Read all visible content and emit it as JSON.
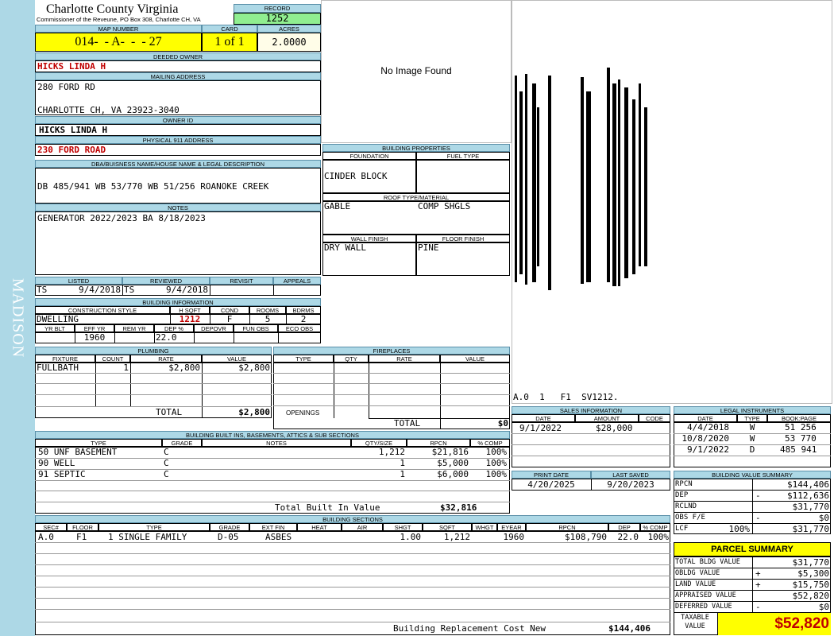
{
  "sidebar_text": "MADISON",
  "county": "Charlotte County Virginia",
  "commissioner": "Commissioner of the Reveune, PO Box 308, Charlotte CH, VA",
  "record": {
    "label": "RECORD",
    "value": "1252"
  },
  "map_number": {
    "label": "MAP NUMBER",
    "value": "014-  - A-  -  - 27"
  },
  "card": {
    "label": "CARD",
    "value": "1 of 1"
  },
  "acres": {
    "label": "ACRES",
    "value": "2.0000"
  },
  "deeded_owner": {
    "label": "DEEDED OWNER",
    "value": "HICKS LINDA H"
  },
  "mailing_address": {
    "label": "MAILING ADDRESS",
    "line1": "280 FORD RD",
    "line2": "CHARLOTTE CH, VA 23923-3040"
  },
  "owner_id": {
    "label": "OWNER ID",
    "value": "HICKS LINDA H"
  },
  "physical_address": {
    "label": "PHYSICAL 911 ADDRESS",
    "value": "230 FORD ROAD"
  },
  "legal": {
    "label": "DBA/BUISNESS NAME/HOUSE NAME & LEGAL DESCRIPTION",
    "value": "DB 485/941 WB 53/770 WB 51/256 ROANOKE CREEK"
  },
  "notes": {
    "label": "NOTES",
    "value": "GENERATOR 2022/2023 BA 8/18/2023"
  },
  "photo": {
    "text": "No Image Found"
  },
  "sketch_caption": "A.0  1   F1  SV1212.",
  "building_properties": {
    "label": "BUILDING PROPERTIES",
    "foundation_label": "FOUNDATION",
    "foundation": "CINDER BLOCK",
    "fuel_label": "FUEL TYPE",
    "fuel": "",
    "roof_label": "ROOF TYPE/MATERIAL",
    "roof_type": "GABLE",
    "roof_material": "COMP SHGLS",
    "wall_label": "WALL FINISH",
    "wall": "DRY WALL",
    "floor_label": "FLOOR FINISH",
    "floor": "PINE"
  },
  "listing": {
    "listed_label": "LISTED",
    "listed_by": "TS",
    "listed_date": "9/4/2018",
    "reviewed_label": "REVIEWED",
    "reviewed_by": "TS",
    "reviewed_date": "9/4/2018",
    "revisit_label": "REVISIT",
    "appeals_label": "APPEALS"
  },
  "building_info": {
    "label": "BUILDING INFORMATION",
    "style_label": "CONSTRUCTION STYLE",
    "style": "DWELLING",
    "hsqft_label": "H SQFT",
    "hsqft": "1212",
    "cond_label": "COND",
    "cond": "F",
    "rooms_label": "ROOMS",
    "rooms": "5",
    "bdrms_label": "BDRMS",
    "bdrms": "2",
    "yrblt_label": "YR BLT",
    "yrblt": "",
    "effyr_label": "EFF YR",
    "effyr": "1960",
    "remyr_label": "REM YR",
    "remyr": "",
    "dep_label": "DEP %",
    "dep": "22.0",
    "depovr_label": "DEPOVR",
    "funobs_label": "FUN OBS",
    "ecoobs_label": "ECO OBS"
  },
  "plumbing": {
    "label": "PLUMBING",
    "headers": [
      "FIXTURE",
      "COUNT",
      "RATE",
      "VALUE"
    ],
    "rows": [
      [
        "FULLBATH",
        "1",
        "$2,800",
        "$2,800"
      ]
    ],
    "total_label": "TOTAL",
    "total": "$2,800"
  },
  "fireplaces": {
    "label": "FIREPLACES",
    "headers": [
      "TYPE",
      "QTY",
      "RATE",
      "VALUE"
    ],
    "openings_label": "OPENINGS",
    "total_label": "TOTAL",
    "total": "$0"
  },
  "builtins": {
    "label": "BUILDING BUILT INS, BASEMENTS, ATTICS & SUB SECTIONS",
    "headers": [
      "TYPE",
      "GRADE",
      "NOTES",
      "QTY/SIZE",
      "RPCN",
      "% COMP"
    ],
    "rows": [
      [
        "50 UNF BASEMENT",
        "C",
        "",
        "1,212",
        "$21,816",
        "100%"
      ],
      [
        "90 WELL",
        "C",
        "",
        "1",
        "$5,000",
        "100%"
      ],
      [
        "91 SEPTIC",
        "C",
        "",
        "1",
        "$6,000",
        "100%"
      ]
    ],
    "total_label": "Total Built In Value",
    "total": "$32,816"
  },
  "sections": {
    "label": "BUILDING SECTIONS",
    "headers": [
      "SEC#",
      "FLOOR",
      "TYPE",
      "GRADE",
      "EXT FIN",
      "HEAT",
      "AIR",
      "SHGT",
      "SQFT",
      "WHGT",
      "EYEAR",
      "RPCN",
      "DEP",
      "% COMP"
    ],
    "rows": [
      [
        "A.0",
        "F1",
        "1 SINGLE FAMILY",
        "D-05",
        "ASBES",
        "",
        "",
        "1.00",
        "1,212",
        "",
        "1960",
        "$108,790",
        "22.0",
        "100%"
      ]
    ],
    "total_label": "Building Replacement Cost New",
    "total": "$144,406"
  },
  "sales": {
    "label": "SALES INFORMATION",
    "headers": [
      "DATE",
      "AMOUNT",
      "CODE"
    ],
    "rows": [
      [
        "9/1/2022",
        "$28,000",
        ""
      ]
    ]
  },
  "legal_instruments": {
    "label": "LEGAL INSTRUMENTS",
    "headers": [
      "DATE",
      "TYPE",
      "BOOK:PAGE"
    ],
    "rows": [
      [
        "4/4/2018",
        "W",
        "51 256"
      ],
      [
        "10/8/2020",
        "W",
        "53 770"
      ],
      [
        "9/1/2022",
        "D",
        "485 941"
      ]
    ]
  },
  "dates": {
    "print_label": "PRINT DATE",
    "print": "4/20/2025",
    "saved_label": "LAST SAVED",
    "saved": "9/20/2023"
  },
  "value_summary": {
    "label": "BUILDING VALUE SUMMARY",
    "rpcn_label": "RPCN",
    "rpcn": "$144,406",
    "dep_label": "DEP",
    "dep_sign": "-",
    "dep": "$112,636",
    "rclnd_label": "RCLND",
    "rclnd": "$31,770",
    "obs_label": "OBS F/E",
    "obs_sign": "-",
    "obs": "$0",
    "lcr_label": "LCF",
    "lcr_pct": "100%",
    "lcr": "$31,770"
  },
  "parcel_summary": {
    "label": "PARCEL SUMMARY",
    "total_bldg_label": "TOTAL BLDG VALUE",
    "total_bldg": "$31,770",
    "obldg_label": "OBLDG VALUE",
    "obldg_sign": "+",
    "obldg": "$5,300",
    "land_label": "LAND VALUE",
    "land_sign": "+",
    "land": "$15,750",
    "appraised_label": "APPRAISED VALUE",
    "appraised": "$52,820",
    "deferred_label": "DEFERRED VALUE",
    "deferred_sign": "-",
    "deferred": "$0",
    "taxable_label1": "TAXABLE",
    "taxable_label2": "VALUE",
    "taxable": "$52,820"
  }
}
